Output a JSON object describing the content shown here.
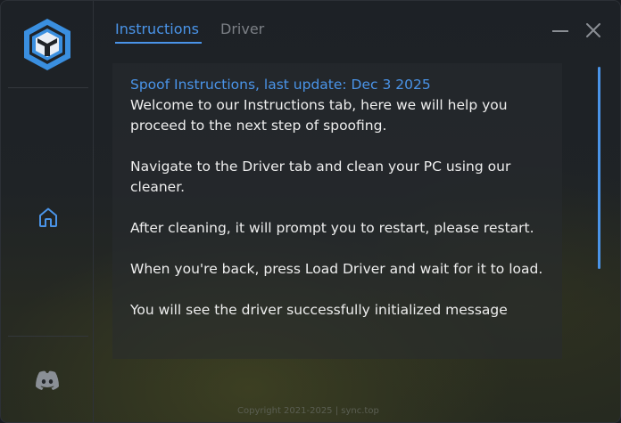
{
  "tabs": [
    {
      "label": "Instructions",
      "active": true
    },
    {
      "label": "Driver",
      "active": false
    }
  ],
  "content": {
    "title": "Spoof Instructions, last update: Dec  3 2025",
    "paragraphs": [
      "Welcome to our Instructions tab, here we will help you proceed to the next step of spoofing.",
      "Navigate to the Driver tab and clean your PC using our cleaner.",
      "After cleaning, it will prompt you to restart, please restart.",
      "When you're back, press Load Driver and wait for it to load.",
      "You will see the driver successfully initialized message"
    ]
  },
  "footer": {
    "text": "Copyright 2021-2025 | sync.top"
  },
  "sidebar": {
    "icons": [
      "logo-icon",
      "home-icon",
      "discord-icon"
    ]
  },
  "colors": {
    "accent": "#4a94e8",
    "inactive_tab": "#7b7f85",
    "text": "#eeeeee"
  }
}
